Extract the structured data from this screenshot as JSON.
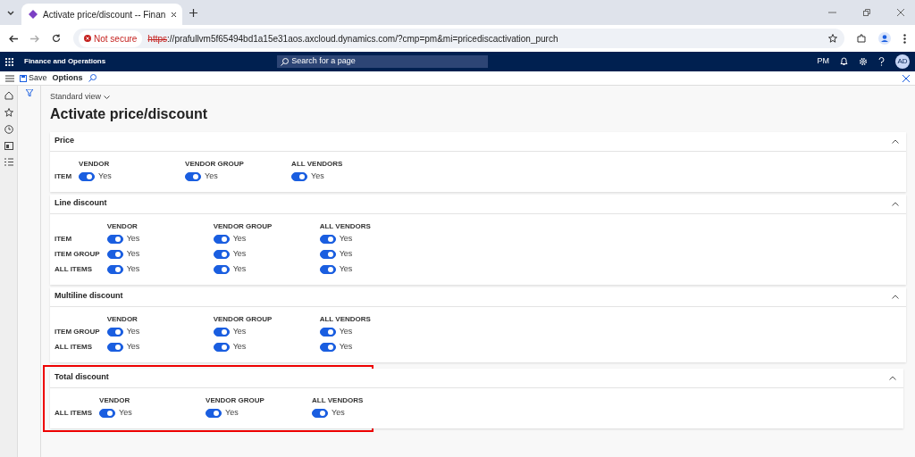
{
  "browser": {
    "tab_title": "Activate price/discount -- Finan",
    "security": "Not secure",
    "url_scheme": "https",
    "url_rest": "://prafullvm5f65494bd1a15e31aos.axcloud.dynamics.com/?cmp=pm&mi=pricediscactivation_purch"
  },
  "app": {
    "title": "Finance and Operations",
    "search_placeholder": "Search for a page",
    "company": "PM",
    "avatar": "AD"
  },
  "toolbar": {
    "save": "Save",
    "options": "Options"
  },
  "view": "Standard view",
  "page_title": "Activate price/discount",
  "sections": [
    {
      "title": "Price",
      "expanded": true,
      "highlighted": false,
      "columns": [
        "VENDOR",
        "VENDOR GROUP",
        "ALL VENDORS"
      ],
      "rows": [
        {
          "label": "ITEM",
          "toggles": [
            {
              "on": true,
              "text": "Yes"
            },
            {
              "on": true,
              "text": "Yes"
            },
            {
              "on": true,
              "text": "Yes"
            }
          ]
        }
      ]
    },
    {
      "title": "Line discount",
      "expanded": true,
      "highlighted": false,
      "columns": [
        "VENDOR",
        "VENDOR GROUP",
        "ALL VENDORS"
      ],
      "rows": [
        {
          "label": "ITEM",
          "toggles": [
            {
              "on": true,
              "text": "Yes"
            },
            {
              "on": true,
              "text": "Yes"
            },
            {
              "on": true,
              "text": "Yes"
            }
          ]
        },
        {
          "label": "ITEM GROUP",
          "toggles": [
            {
              "on": true,
              "text": "Yes"
            },
            {
              "on": true,
              "text": "Yes"
            },
            {
              "on": true,
              "text": "Yes"
            }
          ]
        },
        {
          "label": "ALL ITEMS",
          "toggles": [
            {
              "on": true,
              "text": "Yes"
            },
            {
              "on": true,
              "text": "Yes"
            },
            {
              "on": true,
              "text": "Yes"
            }
          ]
        }
      ]
    },
    {
      "title": "Multiline discount",
      "expanded": true,
      "highlighted": false,
      "columns": [
        "VENDOR",
        "VENDOR GROUP",
        "ALL VENDORS"
      ],
      "rows": [
        {
          "label": "ITEM GROUP",
          "toggles": [
            {
              "on": true,
              "text": "Yes"
            },
            {
              "on": true,
              "text": "Yes"
            },
            {
              "on": true,
              "text": "Yes"
            }
          ]
        },
        {
          "label": "ALL ITEMS",
          "toggles": [
            {
              "on": true,
              "text": "Yes"
            },
            {
              "on": true,
              "text": "Yes"
            },
            {
              "on": true,
              "text": "Yes"
            }
          ]
        }
      ]
    },
    {
      "title": "Total discount",
      "expanded": true,
      "highlighted": true,
      "columns": [
        "VENDOR",
        "VENDOR GROUP",
        "ALL VENDORS"
      ],
      "rows": [
        {
          "label": "ALL ITEMS",
          "toggles": [
            {
              "on": true,
              "text": "Yes"
            },
            {
              "on": true,
              "text": "Yes"
            },
            {
              "on": true,
              "text": "Yes"
            }
          ]
        }
      ]
    }
  ]
}
